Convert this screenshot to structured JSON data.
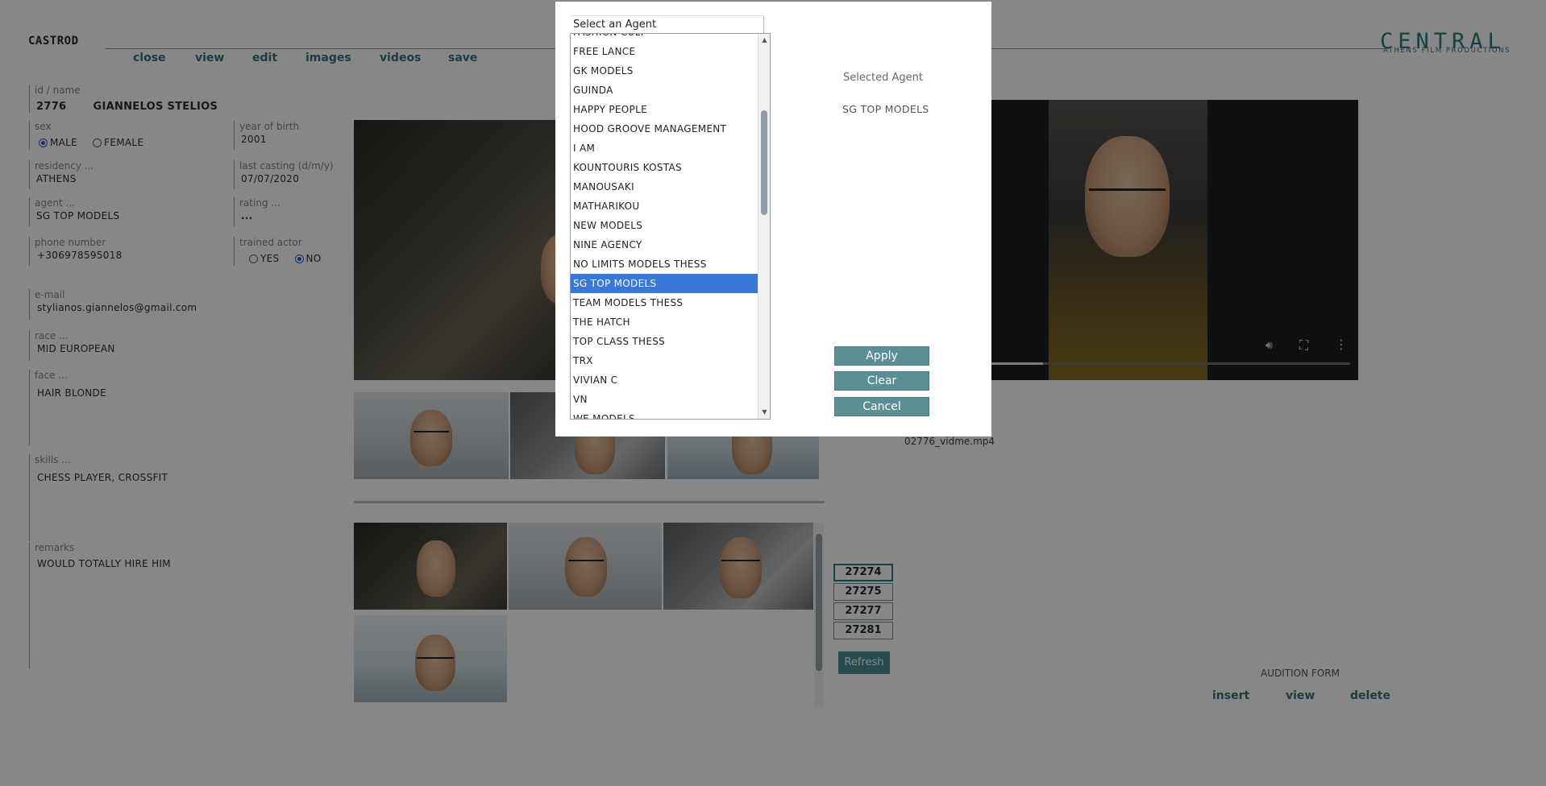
{
  "app": {
    "title": "CASTROD"
  },
  "logo": {
    "main": "CENTRAL",
    "sub": "ATHENS FILM PRODUCTIONS"
  },
  "nav": {
    "close": "close",
    "view": "view",
    "edit": "edit",
    "images": "images",
    "videos": "videos",
    "save": "save"
  },
  "form": {
    "id_name_label": "id / name",
    "id": "2776",
    "name": "GIANNELOS STELIOS",
    "sex_label": "sex",
    "sex_male": "MALE",
    "sex_female": "FEMALE",
    "year_label": "year of birth",
    "year": "2001",
    "residency_label": "residency ...",
    "residency": "ATHENS",
    "last_casting_label": "last casting (d/m/y)",
    "last_casting": "07/07/2020",
    "agent_label": "agent ...",
    "agent": "SG TOP MODELS",
    "rating_label": "rating ...",
    "rating": "...",
    "phone_label": "phone number",
    "phone": "+306978595018",
    "trained_label": "trained actor",
    "trained_yes": "YES",
    "trained_no": "NO",
    "email_label": "e-mail",
    "email": "stylianos.giannelos@gmail.com",
    "race_label": "race ...",
    "race": "MID EUROPEAN",
    "face_label": "face ...",
    "face": "HAIR BLONDE",
    "skills_label": "skills ...",
    "skills": "CHESS PLAYER, CROSSFIT",
    "remarks_label": "remarks",
    "remarks": "WOULD TOTALLY HIRE HIM"
  },
  "thumbs": {
    "ids": [
      "27274",
      "27275",
      "27277",
      "27281"
    ]
  },
  "refresh_label": "Refresh",
  "video": {
    "filename": "02776_vidme.mp4",
    "progress_fraction": 0.3
  },
  "audition": {
    "label": "AUDITION FORM",
    "insert": "insert",
    "view": "view",
    "delete": "delete"
  },
  "dialog": {
    "combo_text": "Select an Agent",
    "options": [
      "FASHION CULT",
      "FREE LANCE",
      "GK MODELS",
      "GUINDA",
      "HAPPY PEOPLE",
      "HOOD GROOVE MANAGEMENT",
      "I AM",
      "KOUNTOURIS KOSTAS",
      "MANOUSAKI",
      "MATHARIKOU",
      "NEW MODELS",
      "NINE AGENCY",
      "NO LIMITS MODELS THESS",
      "SG TOP MODELS",
      "TEAM MODELS THESS",
      "THE HATCH",
      "TOP CLASS THESS",
      "TRX",
      "VIVIAN C",
      "VN",
      "WE MODELS"
    ],
    "selected_label": "Selected Agent",
    "selected_value": "SG TOP MODELS",
    "apply": "Apply",
    "clear": "Clear",
    "cancel": "Cancel"
  }
}
